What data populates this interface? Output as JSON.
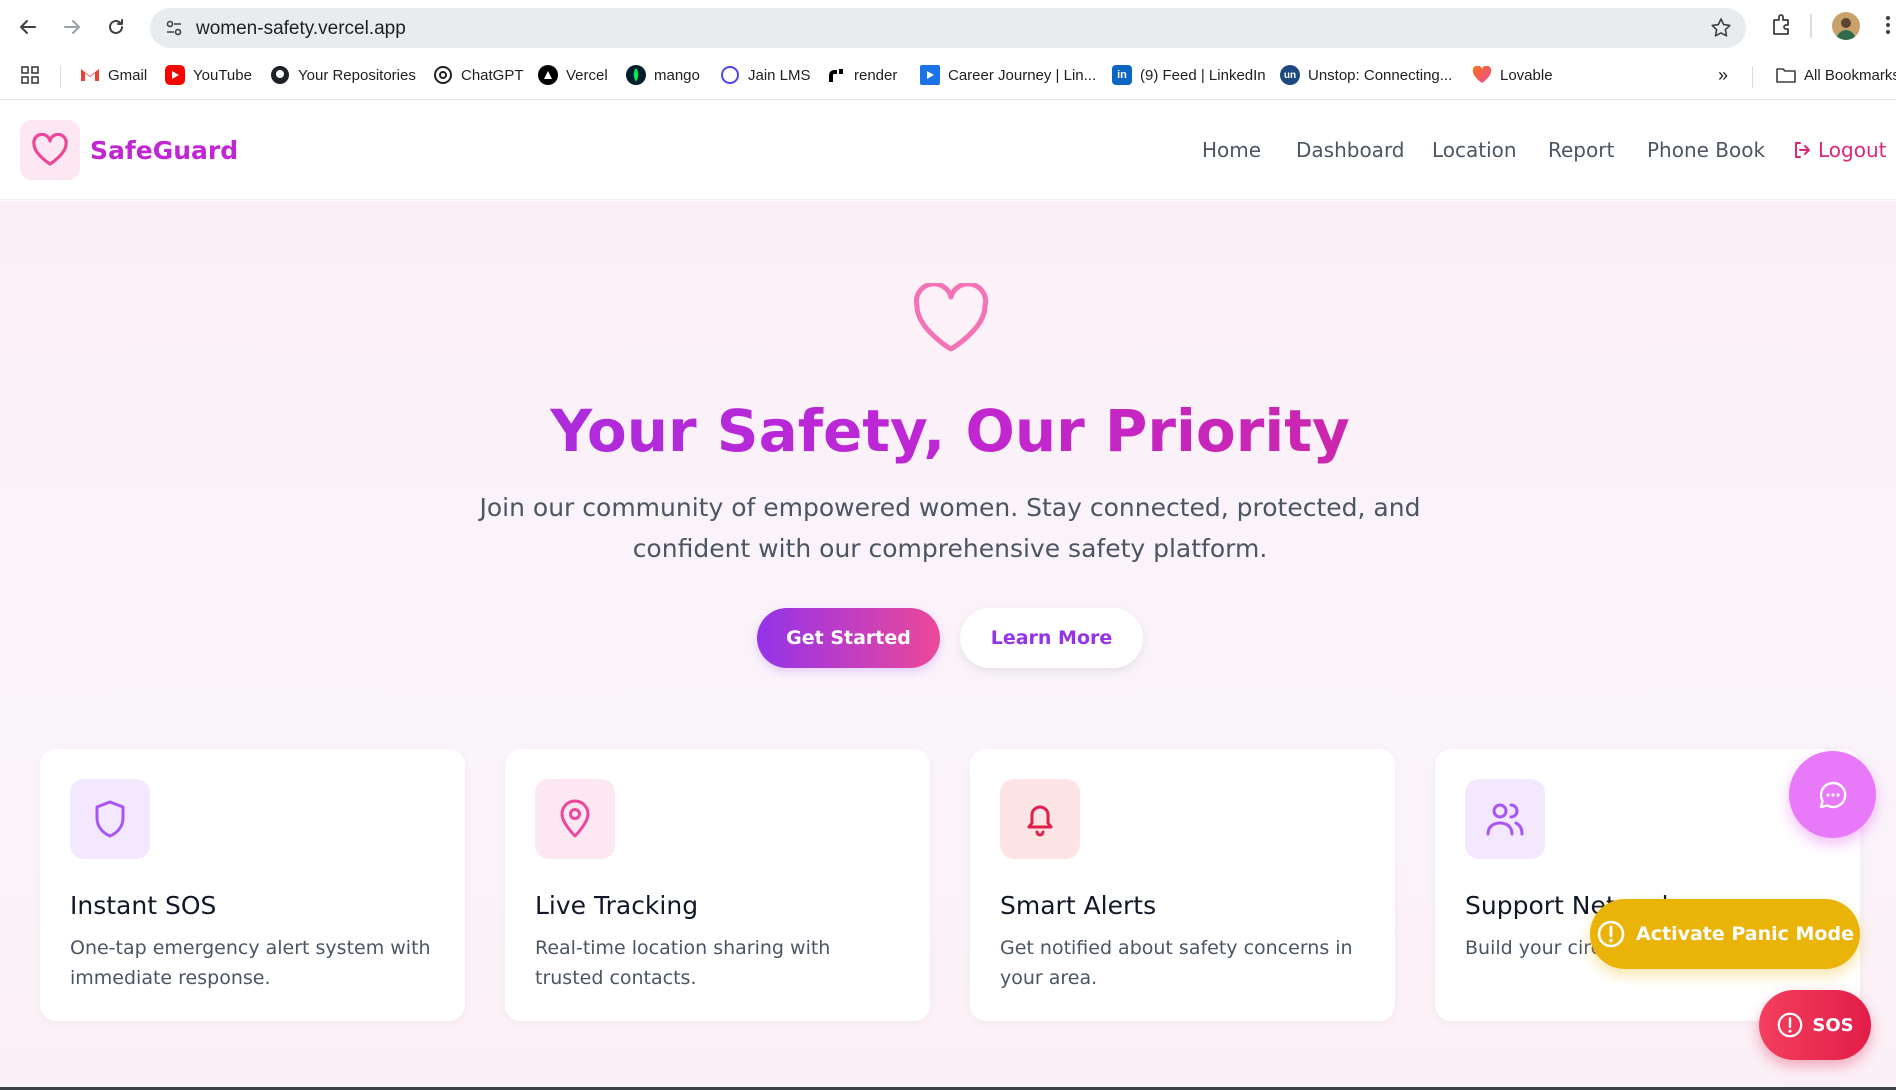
{
  "browser": {
    "url": "women-safety.vercel.app",
    "bookmarks": [
      {
        "label": "Gmail",
        "icon": "gmail-icon"
      },
      {
        "label": "YouTube",
        "icon": "youtube-icon"
      },
      {
        "label": "Your Repositories",
        "icon": "github-icon"
      },
      {
        "label": "ChatGPT",
        "icon": "chatgpt-icon"
      },
      {
        "label": "Vercel",
        "icon": "vercel-icon"
      },
      {
        "label": "mango",
        "icon": "mongodb-icon"
      },
      {
        "label": "Jain LMS",
        "icon": "circle-icon"
      },
      {
        "label": "render",
        "icon": "render-icon"
      },
      {
        "label": "Career Journey | Lin...",
        "icon": "play-icon"
      },
      {
        "label": "(9) Feed | LinkedIn",
        "icon": "linkedin-icon"
      },
      {
        "label": "Unstop: Connecting...",
        "icon": "unstop-icon"
      },
      {
        "label": "Lovable",
        "icon": "lovable-heart-icon"
      }
    ],
    "more_bookmarks": "»",
    "all_bookmarks": "All Bookmarks"
  },
  "header": {
    "brand": "SafeGuard",
    "nav": {
      "home": "Home",
      "dashboard": "Dashboard",
      "location": "Location",
      "report": "Report",
      "phone_book": "Phone Book"
    },
    "logout": "Logout"
  },
  "hero": {
    "title": "Your Safety, Our Priority",
    "subtitle": "Join our community of empowered women. Stay connected, protected, and confident with our comprehensive safety platform.",
    "primary_cta": "Get Started",
    "secondary_cta": "Learn More"
  },
  "features": [
    {
      "title": "Instant SOS",
      "description": "One-tap emergency alert system with immediate response.",
      "icon": "shield-icon"
    },
    {
      "title": "Live Tracking",
      "description": "Real-time location sharing with trusted contacts.",
      "icon": "map-pin-icon"
    },
    {
      "title": "Smart Alerts",
      "description": "Get notified about safety concerns in your area.",
      "icon": "bell-icon"
    },
    {
      "title": "Support Network",
      "description": "Build your circle for safety.",
      "icon": "users-icon"
    }
  ],
  "fabs": {
    "panic": "Activate Panic Mode",
    "sos": "SOS"
  },
  "colors": {
    "brand": "#c026d3",
    "accent_pink": "#db2777",
    "accent_purple": "#9333ea",
    "panic": "#eab308",
    "sos": "#e11d48"
  }
}
